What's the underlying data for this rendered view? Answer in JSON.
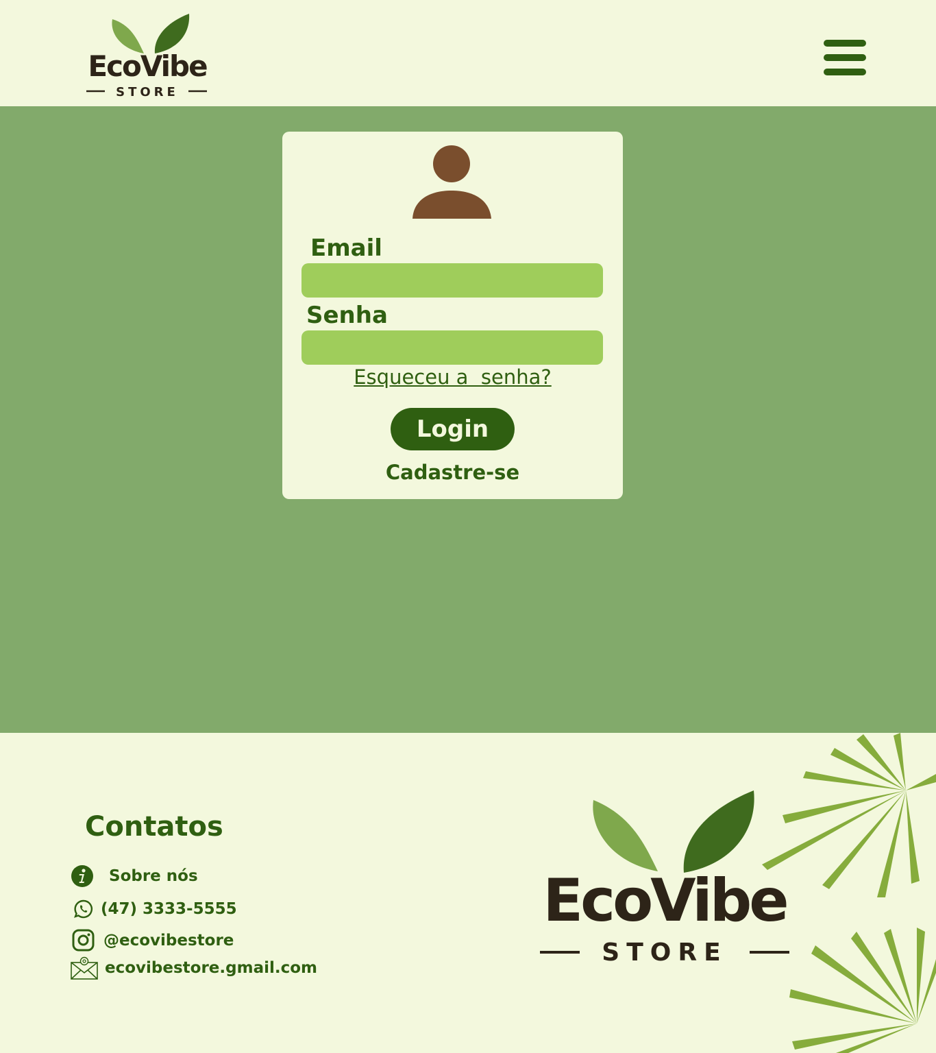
{
  "header": {
    "logo": {
      "brand": "EcoVibe",
      "sub": "STORE"
    },
    "menu_icon": "hamburger-icon"
  },
  "login": {
    "avatar_icon": "user-icon",
    "email_label": "Email",
    "email_value": "",
    "senha_label": "Senha",
    "senha_value": "",
    "forgot_link": "Esqueceu a  senha?",
    "login_button": "Login",
    "signup_link": "Cadastre-se"
  },
  "footer": {
    "title": "Contatos",
    "items": [
      {
        "icon": "info-icon",
        "text": "Sobre nós"
      },
      {
        "icon": "whatsapp-icon",
        "text": "(47) 3333-5555"
      },
      {
        "icon": "instagram-icon",
        "text": "@ecovibestore"
      },
      {
        "icon": "email-icon",
        "text": "ecovibestore.gmail.com"
      }
    ],
    "logo": {
      "brand": "EcoVibe",
      "sub": "STORE"
    }
  },
  "colors": {
    "background_light": "#f3f8dd",
    "main_green": "#82aa6b",
    "dark_green": "#2f5f11",
    "input_green": "#9fcd5b",
    "avatar_brown": "#7a4e2d",
    "logo_text": "#2d2418"
  }
}
